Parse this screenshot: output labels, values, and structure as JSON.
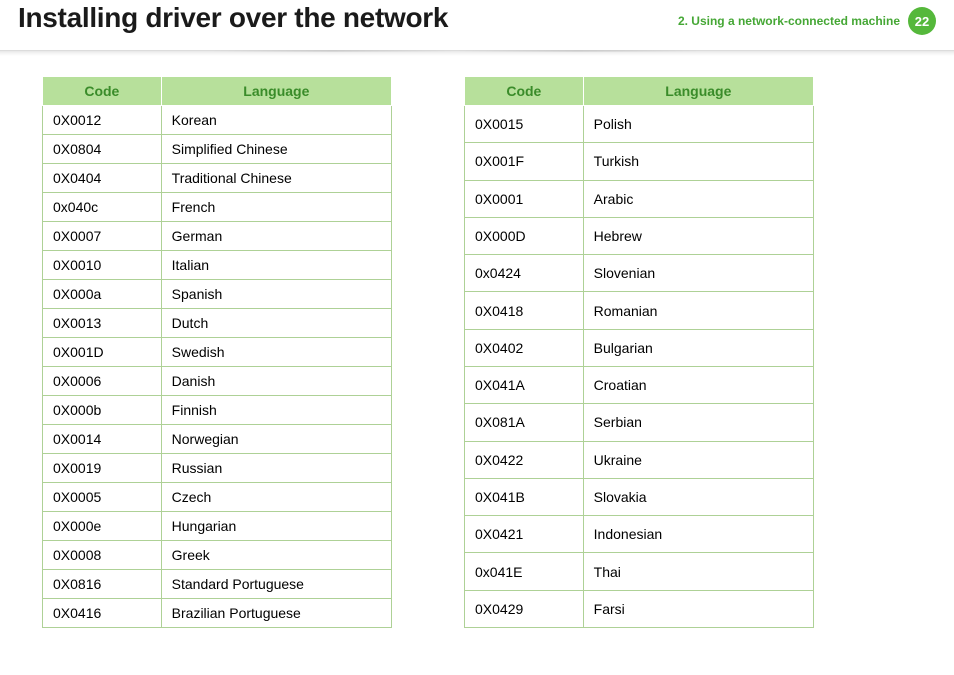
{
  "header": {
    "title": "Installing driver over the network",
    "chapter": "2.  Using a network-connected machine",
    "page": "22"
  },
  "columns": {
    "code": "Code",
    "language": "Language"
  },
  "table_left": [
    {
      "code": "0X0012",
      "language": "Korean"
    },
    {
      "code": "0X0804",
      "language": "Simplified Chinese"
    },
    {
      "code": "0X0404",
      "language": "Traditional Chinese"
    },
    {
      "code": "0x040c",
      "language": "French"
    },
    {
      "code": "0X0007",
      "language": "German"
    },
    {
      "code": "0X0010",
      "language": "Italian"
    },
    {
      "code": "0X000a",
      "language": "Spanish"
    },
    {
      "code": "0X0013",
      "language": "Dutch"
    },
    {
      "code": "0X001D",
      "language": "Swedish"
    },
    {
      "code": "0X0006",
      "language": "Danish"
    },
    {
      "code": "0X000b",
      "language": "Finnish"
    },
    {
      "code": "0X0014",
      "language": "Norwegian"
    },
    {
      "code": "0X0019",
      "language": "Russian"
    },
    {
      "code": "0X0005",
      "language": "Czech"
    },
    {
      "code": "0X000e",
      "language": "Hungarian"
    },
    {
      "code": "0X0008",
      "language": "Greek"
    },
    {
      "code": "0X0816",
      "language": "Standard Portuguese"
    },
    {
      "code": "0X0416",
      "language": "Brazilian Portuguese"
    }
  ],
  "table_right": [
    {
      "code": "0X0015",
      "language": "Polish"
    },
    {
      "code": "0X001F",
      "language": "Turkish"
    },
    {
      "code": "0X0001",
      "language": "Arabic"
    },
    {
      "code": "0X000D",
      "language": "Hebrew"
    },
    {
      "code": "0x0424",
      "language": "Slovenian"
    },
    {
      "code": "0X0418",
      "language": "Romanian"
    },
    {
      "code": "0X0402",
      "language": "Bulgarian"
    },
    {
      "code": "0X041A",
      "language": "Croatian"
    },
    {
      "code": "0X081A",
      "language": "Serbian"
    },
    {
      "code": "0X0422",
      "language": "Ukraine"
    },
    {
      "code": "0X041B",
      "language": "Slovakia"
    },
    {
      "code": "0X0421",
      "language": "Indonesian"
    },
    {
      "code": "0x041E",
      "language": "Thai"
    },
    {
      "code": "0X0429",
      "language": "Farsi"
    }
  ]
}
